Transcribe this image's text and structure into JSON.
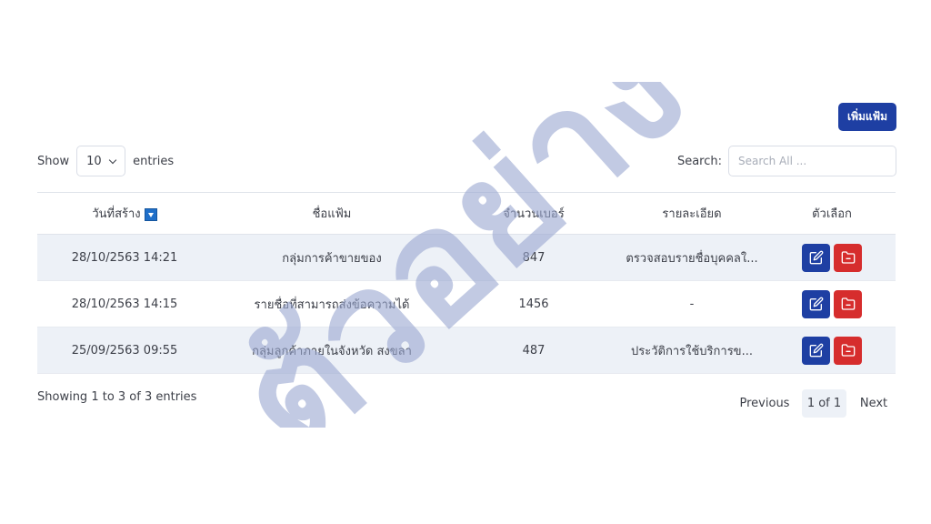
{
  "toolbar": {
    "add_label": "เพิ่มแฟ้ม"
  },
  "length": {
    "show_label": "Show",
    "value": "10",
    "entries_label": "entries"
  },
  "search": {
    "label": "Search:",
    "placeholder": "Search All ..."
  },
  "table": {
    "headers": [
      "วันที่สร้าง",
      "ชื่อแฟ้ม",
      "จำนวนเบอร์",
      "รายละเอียด",
      "ตัวเลือก"
    ],
    "rows": [
      {
        "date": "28/10/2563 14:21",
        "name": "กลุ่มการค้าขายของ",
        "count": "847",
        "detail": "ตรวจสอบรายชื่อบุคคลใ..."
      },
      {
        "date": "28/10/2563 14:15",
        "name": "รายชื่อที่สามารถส่งข้อความได้",
        "count": "1456",
        "detail": "-"
      },
      {
        "date": "25/09/2563 09:55",
        "name": "กลุ่มลูกค้าภายในจังหวัด สงขลา",
        "count": "487",
        "detail": "ประวัติการใช้บริการข..."
      }
    ]
  },
  "footer": {
    "info": "Showing 1 to 3 of 3 entries"
  },
  "pagination": {
    "previous": "Previous",
    "current": "1 of 1",
    "next": "Next"
  },
  "watermark": {
    "text": "ตัวอย่าง"
  },
  "colors": {
    "primary": "#1e3fa3",
    "danger": "#d62d2d",
    "row_stripe": "#edf1f7",
    "watermark": "#9aa6d0"
  },
  "icons": {
    "edit": "edit-icon",
    "delete": "folder-minus-icon",
    "sort": "sort-desc-icon"
  }
}
